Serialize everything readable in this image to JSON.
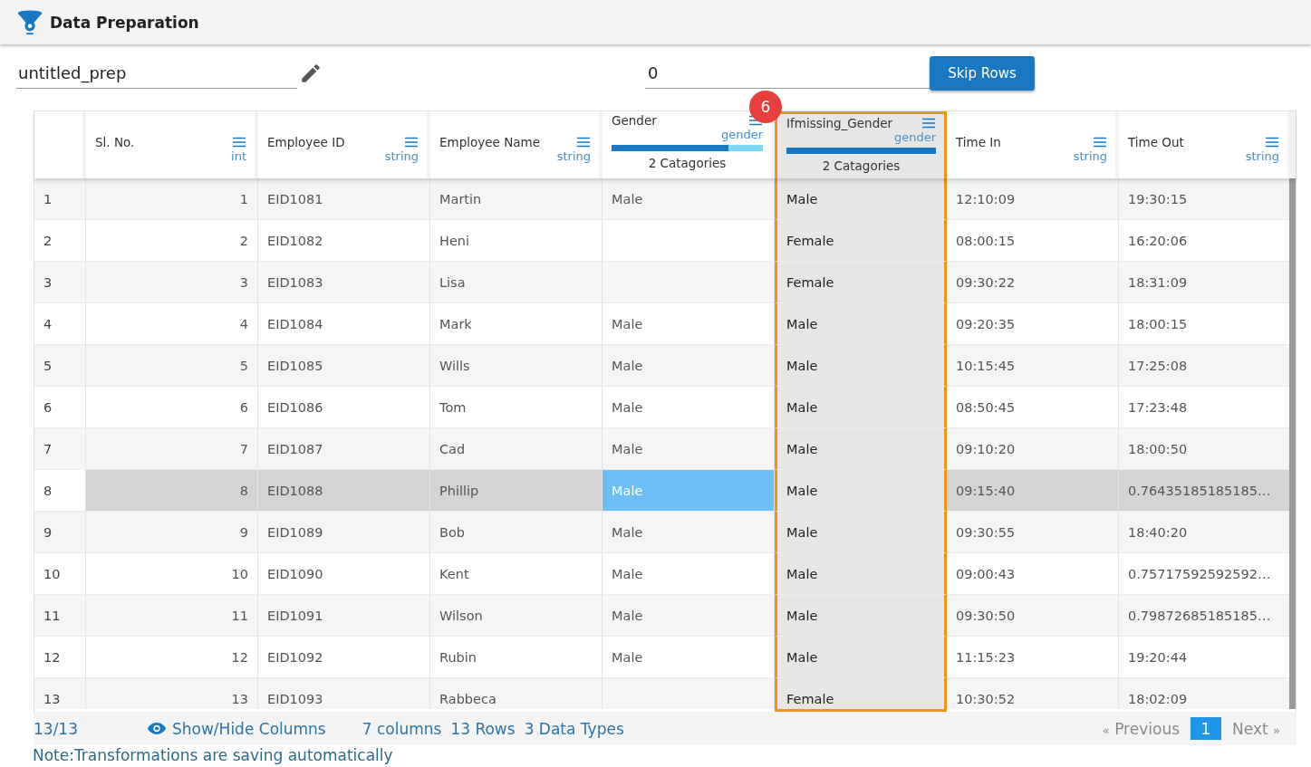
{
  "header": {
    "title": "Data Preparation"
  },
  "name_field": {
    "value": "untitled_prep"
  },
  "skip_field": {
    "value": "0"
  },
  "skip_button": {
    "label": "Skip Rows"
  },
  "callout": {
    "label": "6"
  },
  "table": {
    "columns": [
      {
        "name": "Sl. No.",
        "type": "int",
        "kind": "number",
        "highlighted": false
      },
      {
        "name": "Employee ID",
        "type": "string",
        "kind": "text",
        "highlighted": false
      },
      {
        "name": "Employee Name",
        "type": "string",
        "kind": "text",
        "highlighted": false
      },
      {
        "name": "Gender",
        "type": "gender",
        "kind": "text",
        "highlighted": false,
        "categories": {
          "label": "2 Catagories",
          "level": 0.77
        }
      },
      {
        "name": "Ifmissing_Gender",
        "type": "gender",
        "kind": "text",
        "highlighted": true,
        "categories": {
          "label": "2 Catagories",
          "level": 1
        }
      },
      {
        "name": "Time In",
        "type": "string",
        "kind": "text",
        "highlighted": false
      },
      {
        "name": "Time Out",
        "type": "string",
        "kind": "text",
        "highlighted": false
      }
    ],
    "rows": [
      {
        "index": "1",
        "selected": false,
        "cells": [
          {
            "text": "1",
            "selected": false
          },
          {
            "text": "EID1081",
            "selected": false
          },
          {
            "text": "Martin",
            "selected": false
          },
          {
            "text": "Male",
            "selected": false
          },
          {
            "text": "Male",
            "selected": false
          },
          {
            "text": "12:10:09",
            "selected": false
          },
          {
            "text": "19:30:15",
            "selected": false
          }
        ]
      },
      {
        "index": "2",
        "selected": false,
        "cells": [
          {
            "text": "2",
            "selected": false
          },
          {
            "text": "EID1082",
            "selected": false
          },
          {
            "text": "Heni",
            "selected": false
          },
          {
            "selected": false
          },
          {
            "text": "Female",
            "selected": false
          },
          {
            "text": "08:00:15",
            "selected": false
          },
          {
            "text": "16:20:06",
            "selected": false
          }
        ]
      },
      {
        "index": "3",
        "selected": false,
        "cells": [
          {
            "text": "3",
            "selected": false
          },
          {
            "text": "EID1083",
            "selected": false
          },
          {
            "text": "Lisa",
            "selected": false
          },
          {
            "selected": false
          },
          {
            "text": "Female",
            "selected": false
          },
          {
            "text": "09:30:22",
            "selected": false
          },
          {
            "text": "18:31:09",
            "selected": false
          }
        ]
      },
      {
        "index": "4",
        "selected": false,
        "cells": [
          {
            "text": "4",
            "selected": false
          },
          {
            "text": "EID1084",
            "selected": false
          },
          {
            "text": "Mark",
            "selected": false
          },
          {
            "text": "Male",
            "selected": false
          },
          {
            "text": "Male",
            "selected": false
          },
          {
            "text": "09:20:35",
            "selected": false
          },
          {
            "text": "18:00:15",
            "selected": false
          }
        ]
      },
      {
        "index": "5",
        "selected": false,
        "cells": [
          {
            "text": "5",
            "selected": false
          },
          {
            "text": "EID1085",
            "selected": false
          },
          {
            "text": "Wills",
            "selected": false
          },
          {
            "text": "Male",
            "selected": false
          },
          {
            "text": "Male",
            "selected": false
          },
          {
            "text": "10:15:45",
            "selected": false
          },
          {
            "text": "17:25:08",
            "selected": false
          }
        ]
      },
      {
        "index": "6",
        "selected": false,
        "cells": [
          {
            "text": "6",
            "selected": false
          },
          {
            "text": "EID1086",
            "selected": false
          },
          {
            "text": "Tom",
            "selected": false
          },
          {
            "text": "Male",
            "selected": false
          },
          {
            "text": "Male",
            "selected": false
          },
          {
            "text": "08:50:45",
            "selected": false
          },
          {
            "text": "17:23:48",
            "selected": false
          }
        ]
      },
      {
        "index": "7",
        "selected": false,
        "cells": [
          {
            "text": "7",
            "selected": false
          },
          {
            "text": "EID1087",
            "selected": false
          },
          {
            "text": "Cad",
            "selected": false
          },
          {
            "text": "Male",
            "selected": false
          },
          {
            "text": "Male",
            "selected": false
          },
          {
            "text": "09:10:20",
            "selected": false
          },
          {
            "text": "18:00:50",
            "selected": false
          }
        ]
      },
      {
        "index": "8",
        "selected": true,
        "cells": [
          {
            "text": "8",
            "selected": false
          },
          {
            "text": "EID1088",
            "selected": false
          },
          {
            "text": "Phillip",
            "selected": false
          },
          {
            "text": "Male",
            "selected": true
          },
          {
            "text": "Male",
            "selected": false
          },
          {
            "text": "09:15:40",
            "selected": false
          },
          {
            "text": "0.76435185185185…",
            "selected": false
          }
        ]
      },
      {
        "index": "9",
        "selected": false,
        "cells": [
          {
            "text": "9",
            "selected": false
          },
          {
            "text": "EID1089",
            "selected": false
          },
          {
            "text": "Bob",
            "selected": false
          },
          {
            "text": "Male",
            "selected": false
          },
          {
            "text": "Male",
            "selected": false
          },
          {
            "text": "09:30:55",
            "selected": false
          },
          {
            "text": "18:40:20",
            "selected": false
          }
        ]
      },
      {
        "index": "10",
        "selected": false,
        "cells": [
          {
            "text": "10",
            "selected": false
          },
          {
            "text": "EID1090",
            "selected": false
          },
          {
            "text": "Kent",
            "selected": false
          },
          {
            "text": "Male",
            "selected": false
          },
          {
            "text": "Male",
            "selected": false
          },
          {
            "text": "09:00:43",
            "selected": false
          },
          {
            "text": "0.75717592592592…",
            "selected": false
          }
        ]
      },
      {
        "index": "11",
        "selected": false,
        "cells": [
          {
            "text": "11",
            "selected": false
          },
          {
            "text": "EID1091",
            "selected": false
          },
          {
            "text": "Wilson",
            "selected": false
          },
          {
            "text": "Male",
            "selected": false
          },
          {
            "text": "Male",
            "selected": false
          },
          {
            "text": "09:30:50",
            "selected": false
          },
          {
            "text": "0.79872685185185…",
            "selected": false
          }
        ]
      },
      {
        "index": "12",
        "selected": false,
        "cells": [
          {
            "text": "12",
            "selected": false
          },
          {
            "text": "EID1092",
            "selected": false
          },
          {
            "text": "Rubin",
            "selected": false
          },
          {
            "text": "Male",
            "selected": false
          },
          {
            "text": "Male",
            "selected": false
          },
          {
            "text": "11:15:23",
            "selected": false
          },
          {
            "text": "19:20:44",
            "selected": false
          }
        ]
      },
      {
        "index": "13",
        "selected": false,
        "cells": [
          {
            "text": "13",
            "selected": false
          },
          {
            "text": "EID1093",
            "selected": false
          },
          {
            "text": "Rabbeca",
            "selected": false
          },
          {
            "selected": false
          },
          {
            "text": "Female",
            "selected": false
          },
          {
            "text": "10:30:52",
            "selected": false
          },
          {
            "text": "18:02:09",
            "selected": false
          }
        ]
      }
    ]
  },
  "footer": {
    "count": "13/13",
    "show_hide": "Show/Hide Columns",
    "stats": [
      "7 columns",
      "13 Rows",
      "3 Data Types"
    ],
    "pagination": {
      "previous": {
        "label": "Previous",
        "arrow": "«",
        "disabled": true
      },
      "pages": [
        {
          "label": "1",
          "selected": true
        }
      ],
      "next": {
        "label": "Next",
        "arrow": "»",
        "disabled": true
      }
    }
  },
  "note": "Note:Transformations are saving automatically"
}
